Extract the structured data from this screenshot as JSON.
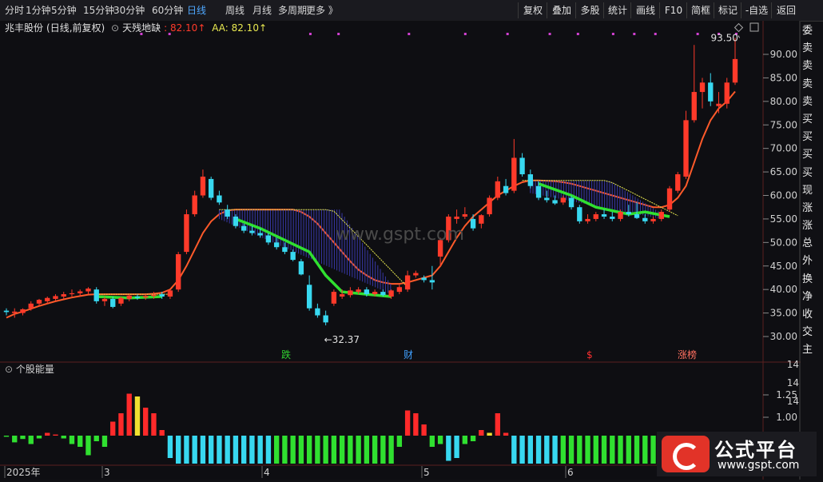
{
  "toolbar": {
    "periods": [
      "分时",
      "1分钟",
      "5分钟",
      "15分钟",
      "30分钟",
      "60分钟",
      "日线",
      "周线",
      "月线",
      "多周期",
      "更多 》"
    ],
    "active_period": "日线",
    "right_buttons": [
      "复权",
      "叠加",
      "多股",
      "统计",
      "画线",
      "F10",
      "简框",
      "标记",
      "-自选",
      "返回"
    ]
  },
  "header": {
    "stock_name": "兆丰股份",
    "mode": "(日线,前复权)",
    "indicator_name": "天残地缺",
    "indicator_value": ": 82.10↑",
    "aa_value": "AA: 82.10↑"
  },
  "colors": {
    "up": "#ff3a2a",
    "down": "#38d8f0",
    "ma": "#ff5a2a",
    "fill": "#3838a8",
    "green_line": "#30e030",
    "yellow": "#e8e850",
    "price_text": "#d0d0d0",
    "purple_dots": "#d040d0",
    "bar_green": "#30e030",
    "bar_cyan": "#38d8f0",
    "bar_red": "#ff2a2a",
    "bar_yellow": "#f0e030"
  },
  "price_axis": {
    "ticks": [
      "90.00",
      "85.00",
      "80.00",
      "75.00",
      "70.00",
      "65.00",
      "60.00",
      "55.00",
      "50.00",
      "45.00",
      "40.00",
      "35.00",
      "30.00"
    ]
  },
  "volume_axis": {
    "ticks": [
      "1.25",
      "1.00"
    ],
    "top_labels": [
      "14",
      "14",
      "14"
    ]
  },
  "annotations": {
    "high_label": "93.50",
    "low_label": "←32.37",
    "watermark": "www.gspt.com",
    "event_labels": [
      "跌",
      "财",
      "$",
      "涨榜"
    ]
  },
  "date_axis": [
    "2025年",
    "3",
    "4",
    "5",
    "6"
  ],
  "sub_chart": {
    "title": "个股能量"
  },
  "right_list": [
    "委",
    "卖",
    "卖",
    "卖",
    "卖",
    "买",
    "买",
    "买",
    "买",
    "现",
    "涨",
    "涨",
    "总",
    "外",
    "换",
    "净",
    "收",
    "交",
    "主"
  ],
  "logo": {
    "name": "公式平台",
    "url_text": "www.gspt.com"
  },
  "chart_data": {
    "type": "candlestick",
    "ylim": [
      27,
      95
    ],
    "candles": [
      [
        35.5,
        36,
        34.5,
        35.2
      ],
      [
        35,
        36,
        34,
        35.3
      ],
      [
        35,
        36,
        34.5,
        35.8
      ],
      [
        36,
        37.5,
        35.5,
        37
      ],
      [
        37,
        38,
        36.5,
        37.8
      ],
      [
        37.5,
        38.5,
        37,
        38.2
      ],
      [
        38,
        39,
        37.5,
        38.6
      ],
      [
        38.5,
        39.5,
        38,
        39
      ],
      [
        39,
        40,
        38.5,
        39.2
      ],
      [
        39.2,
        40,
        38.5,
        39.6
      ],
      [
        39.6,
        40.5,
        39,
        40.2
      ],
      [
        40,
        40.5,
        37,
        37.5
      ],
      [
        37.5,
        38.5,
        36.5,
        38
      ],
      [
        38,
        38.5,
        36,
        36.3
      ],
      [
        37,
        38.5,
        36.5,
        38.2
      ],
      [
        38,
        39,
        37.5,
        38.7
      ],
      [
        38.5,
        39,
        37.8,
        38.2
      ],
      [
        38.3,
        39,
        37.8,
        38.6
      ],
      [
        38.6,
        39.5,
        38,
        38.9
      ],
      [
        39,
        39.5,
        38,
        38.5
      ],
      [
        38.5,
        40,
        38,
        39.8
      ],
      [
        40,
        48,
        39.5,
        47.5
      ],
      [
        48,
        57,
        47.5,
        56
      ],
      [
        56,
        61,
        55.5,
        60
      ],
      [
        60,
        65.5,
        59.5,
        64
      ],
      [
        63.5,
        64,
        59,
        59.5
      ],
      [
        60,
        61,
        58,
        58.5
      ],
      [
        57,
        58,
        55,
        55.5
      ],
      [
        55.5,
        56,
        53,
        53.5
      ],
      [
        53.5,
        54,
        52,
        52.5
      ],
      [
        52.5,
        53.5,
        51.5,
        52
      ],
      [
        52,
        53,
        51,
        51.5
      ],
      [
        51.5,
        52,
        49.5,
        50
      ],
      [
        50,
        51,
        48.5,
        49
      ],
      [
        49,
        50,
        47.5,
        48
      ],
      [
        48,
        48.5,
        46,
        46.3
      ],
      [
        46,
        46.5,
        43,
        43.2
      ],
      [
        41,
        43,
        35.5,
        36
      ],
      [
        36,
        37,
        34,
        34.5
      ],
      [
        34.5,
        35.5,
        32.37,
        33
      ],
      [
        37,
        40,
        36.5,
        39.5
      ],
      [
        38.5,
        40,
        38,
        39
      ],
      [
        38.8,
        40.5,
        38.3,
        39.8
      ],
      [
        39.5,
        40.5,
        39,
        40
      ],
      [
        40,
        40.5,
        38.5,
        39
      ],
      [
        39,
        40,
        38.5,
        39.5
      ],
      [
        39.5,
        40,
        38.5,
        38.8
      ],
      [
        38.5,
        40,
        38,
        39.8
      ],
      [
        39.5,
        41,
        39,
        40.5
      ],
      [
        40,
        44,
        39.5,
        43
      ],
      [
        43,
        44,
        42.5,
        43.5
      ],
      [
        42.5,
        43,
        41.5,
        42
      ],
      [
        42,
        45,
        40,
        41.5
      ],
      [
        47,
        51,
        45,
        50.5
      ],
      [
        50.5,
        56,
        50,
        55.5
      ],
      [
        55,
        57,
        54,
        55.5
      ],
      [
        55.5,
        57.5,
        55,
        56
      ],
      [
        55,
        56,
        52.5,
        53
      ],
      [
        54,
        56,
        53,
        55.8
      ],
      [
        56,
        60,
        55.5,
        59.5
      ],
      [
        59.5,
        64,
        59,
        63
      ],
      [
        62,
        63.5,
        60,
        60.5
      ],
      [
        61,
        72,
        60.5,
        68
      ],
      [
        68,
        69,
        64,
        64.5
      ],
      [
        64.5,
        65.5,
        61.5,
        62
      ],
      [
        62,
        63,
        59,
        59.5
      ],
      [
        59.5,
        61,
        58.5,
        59
      ],
      [
        59,
        60,
        58,
        58.3
      ],
      [
        58.5,
        60,
        58,
        59.5
      ],
      [
        59.5,
        60,
        57,
        57.5
      ],
      [
        57.5,
        58,
        54,
        54.5
      ],
      [
        54.5,
        56,
        54,
        55
      ],
      [
        55,
        56.5,
        54.5,
        56
      ],
      [
        56,
        57,
        55,
        55.5
      ],
      [
        55.5,
        56.5,
        54.5,
        55
      ],
      [
        55,
        57,
        54.5,
        56.5
      ],
      [
        56.5,
        58,
        55.5,
        56
      ],
      [
        56,
        58.5,
        55,
        55.2
      ],
      [
        55.2,
        56,
        54,
        54.5
      ],
      [
        54.5,
        55.5,
        54,
        55
      ],
      [
        55,
        57,
        54.5,
        56.5
      ],
      [
        57,
        62,
        56.5,
        61.5
      ],
      [
        61,
        65,
        60.5,
        64.5
      ],
      [
        64,
        78,
        63.5,
        76
      ],
      [
        76,
        92,
        75.5,
        82
      ],
      [
        82,
        85,
        78.5,
        84
      ],
      [
        84,
        86,
        79,
        80
      ],
      [
        79,
        82,
        77.5,
        79.5
      ],
      [
        79.5,
        85,
        78.5,
        84
      ],
      [
        84,
        93.5,
        83.5,
        89
      ]
    ],
    "volume_energy": [
      -0.02,
      -0.12,
      -0.06,
      -0.15,
      -0.05,
      0.05,
      0.02,
      -0.05,
      -0.15,
      -0.2,
      -0.35,
      -0.1,
      -0.2,
      0.25,
      0.4,
      0.75,
      0.7,
      0.5,
      0.4,
      0.1,
      -0.4,
      -0.5,
      -0.5,
      -0.5,
      -0.5,
      -0.5,
      -0.5,
      -0.5,
      -0.5,
      -0.5,
      -0.5,
      -0.5,
      -0.5,
      -0.5,
      -0.5,
      -0.5,
      -0.5,
      -0.5,
      -0.5,
      -0.5,
      -0.5,
      -0.5,
      -0.5,
      -0.5,
      -0.5,
      -0.5,
      -0.5,
      -0.5,
      -0.2,
      0.45,
      0.4,
      0.2,
      -0.2,
      -0.15,
      -0.45,
      -0.4,
      -0.15,
      -0.1,
      0.1,
      0.05,
      0.4,
      0.05,
      -0.5,
      -0.5,
      -0.5,
      -0.5,
      -0.5,
      -0.5,
      -0.5,
      -0.5,
      -0.5,
      -0.5,
      -0.5,
      -0.5,
      -0.5,
      -0.5,
      -0.5,
      -0.5,
      -0.5,
      -0.5,
      -0.5,
      -0.5,
      -0.5,
      -0.5,
      -0.5,
      -0.5,
      -0.5,
      -0.5,
      -0.5,
      -0.5
    ],
    "ma": [
      34,
      34.8,
      35.3,
      35.9,
      36.5,
      37,
      37.5,
      37.9,
      38.3,
      38.6,
      38.9,
      39,
      39,
      39,
      39,
      39,
      39,
      39,
      39.1,
      39.3,
      40,
      42,
      45,
      48.5,
      52,
      54.5,
      56,
      56.8,
      57,
      57,
      57,
      57,
      57,
      57,
      57,
      57,
      56.5,
      55.5,
      54,
      52,
      50,
      48,
      46,
      44.2,
      43,
      42,
      41.5,
      41.2,
      41.2,
      41.5,
      42,
      42.5,
      43,
      45,
      48,
      51,
      53.5,
      55.5,
      57,
      58.5,
      60,
      61,
      62,
      62.8,
      63.2,
      63.2,
      63.1,
      63,
      62.8,
      62.5,
      62,
      61.5,
      61,
      60.5,
      60,
      59.5,
      59,
      58.5,
      58,
      57.5,
      57.5,
      58,
      59.5,
      62,
      67,
      72,
      76,
      78.5,
      80,
      82.1
    ]
  }
}
